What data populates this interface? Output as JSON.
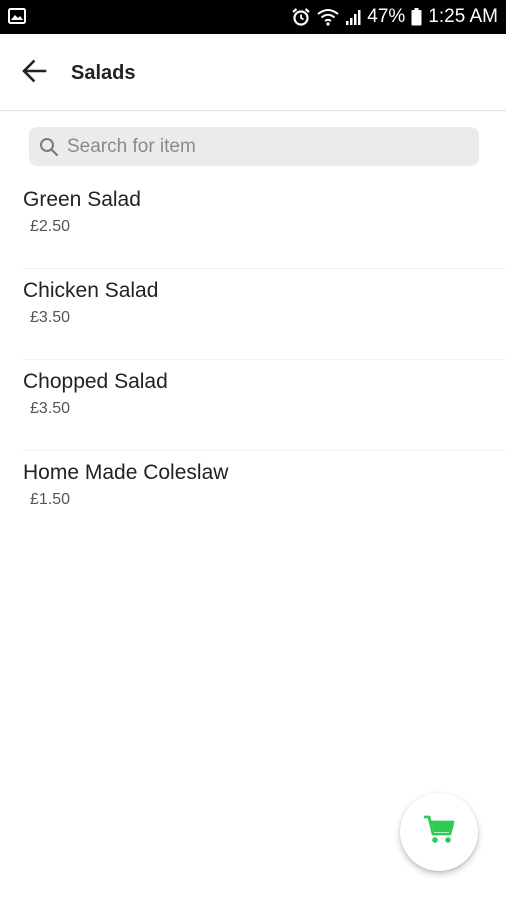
{
  "status_bar": {
    "battery_percent": "47%",
    "time": "1:25 AM",
    "icons": [
      "image-notification-icon",
      "alarm-icon",
      "wifi-icon",
      "signal-icon",
      "battery-icon"
    ]
  },
  "app_bar": {
    "title": "Salads",
    "back_icon": "arrow-back-icon"
  },
  "search": {
    "placeholder": "Search for item",
    "value": "",
    "icon": "search-icon"
  },
  "items": [
    {
      "name": "Green Salad",
      "price": "£2.50"
    },
    {
      "name": "Chicken Salad",
      "price": "£3.50"
    },
    {
      "name": "Chopped Salad",
      "price": "£3.50"
    },
    {
      "name": "Home Made Coleslaw",
      "price": "£1.50"
    }
  ],
  "fab": {
    "icon": "shopping-cart-icon"
  },
  "colors": {
    "status_bar_bg": "#000000",
    "accent_green": "#2ecc55",
    "search_bg": "#ebebeb"
  }
}
